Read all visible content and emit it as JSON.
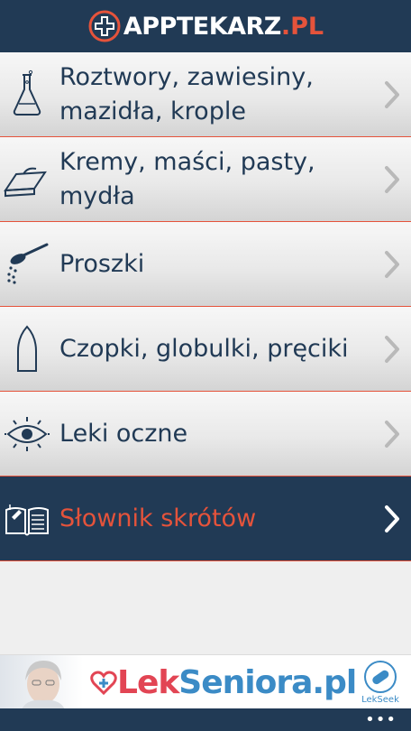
{
  "header": {
    "logo_text": "APPTEKARZ",
    "logo_ext": ".PL",
    "brand_color": "#e5533b",
    "bar_color": "#213a55"
  },
  "menu": {
    "items": [
      {
        "label_line1": "Roztwory, zawiesiny,",
        "label_line2": "mazidła, krople",
        "icon": "flask-icon"
      },
      {
        "label_line1": "Kremy, maści, pasty,",
        "label_line2": "mydła",
        "icon": "ointment-jar-icon"
      },
      {
        "label_line1": "Proszki",
        "label_line2": "",
        "icon": "powder-spoon-icon"
      },
      {
        "label_line1": "Czopki, globulki, pręciki",
        "label_line2": "",
        "icon": "suppository-icon"
      },
      {
        "label_line1": "Leki oczne",
        "label_line2": "",
        "icon": "eye-icon"
      },
      {
        "label_line1": "Słownik skrótów",
        "label_line2": "",
        "icon": "book-icon",
        "active": true
      }
    ]
  },
  "banner": {
    "brand_lek": "Lek",
    "brand_seniora": "Seniora",
    "brand_pl": ".pl",
    "partner_text": "LekSeek",
    "lek_color": "#e24554",
    "seniora_color": "#3b8bc6"
  },
  "appbar": {
    "more": "•••"
  }
}
